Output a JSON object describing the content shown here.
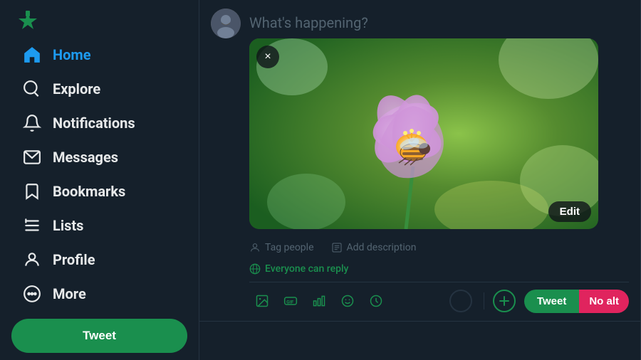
{
  "sidebar": {
    "logo_label": "Twitter Home",
    "items": [
      {
        "id": "home",
        "label": "Home",
        "active": true
      },
      {
        "id": "explore",
        "label": "Explore",
        "active": false
      },
      {
        "id": "notifications",
        "label": "Notifications",
        "active": false
      },
      {
        "id": "messages",
        "label": "Messages",
        "active": false
      },
      {
        "id": "bookmarks",
        "label": "Bookmarks",
        "active": false
      },
      {
        "id": "lists",
        "label": "Lists",
        "active": false
      },
      {
        "id": "profile",
        "label": "Profile",
        "active": false
      },
      {
        "id": "more",
        "label": "More",
        "active": false
      }
    ],
    "tweet_button_label": "Tweet"
  },
  "compose": {
    "placeholder": "What's happening?",
    "reply_setting": "Everyone can reply",
    "tag_people": "Tag people",
    "add_description": "Add description",
    "tweet_label": "Tweet",
    "no_alt_label": "No alt"
  },
  "image": {
    "close_label": "×",
    "edit_label": "Edit"
  },
  "toolbar": {
    "icons": [
      "photo",
      "gif",
      "list",
      "emoji",
      "schedule"
    ]
  }
}
